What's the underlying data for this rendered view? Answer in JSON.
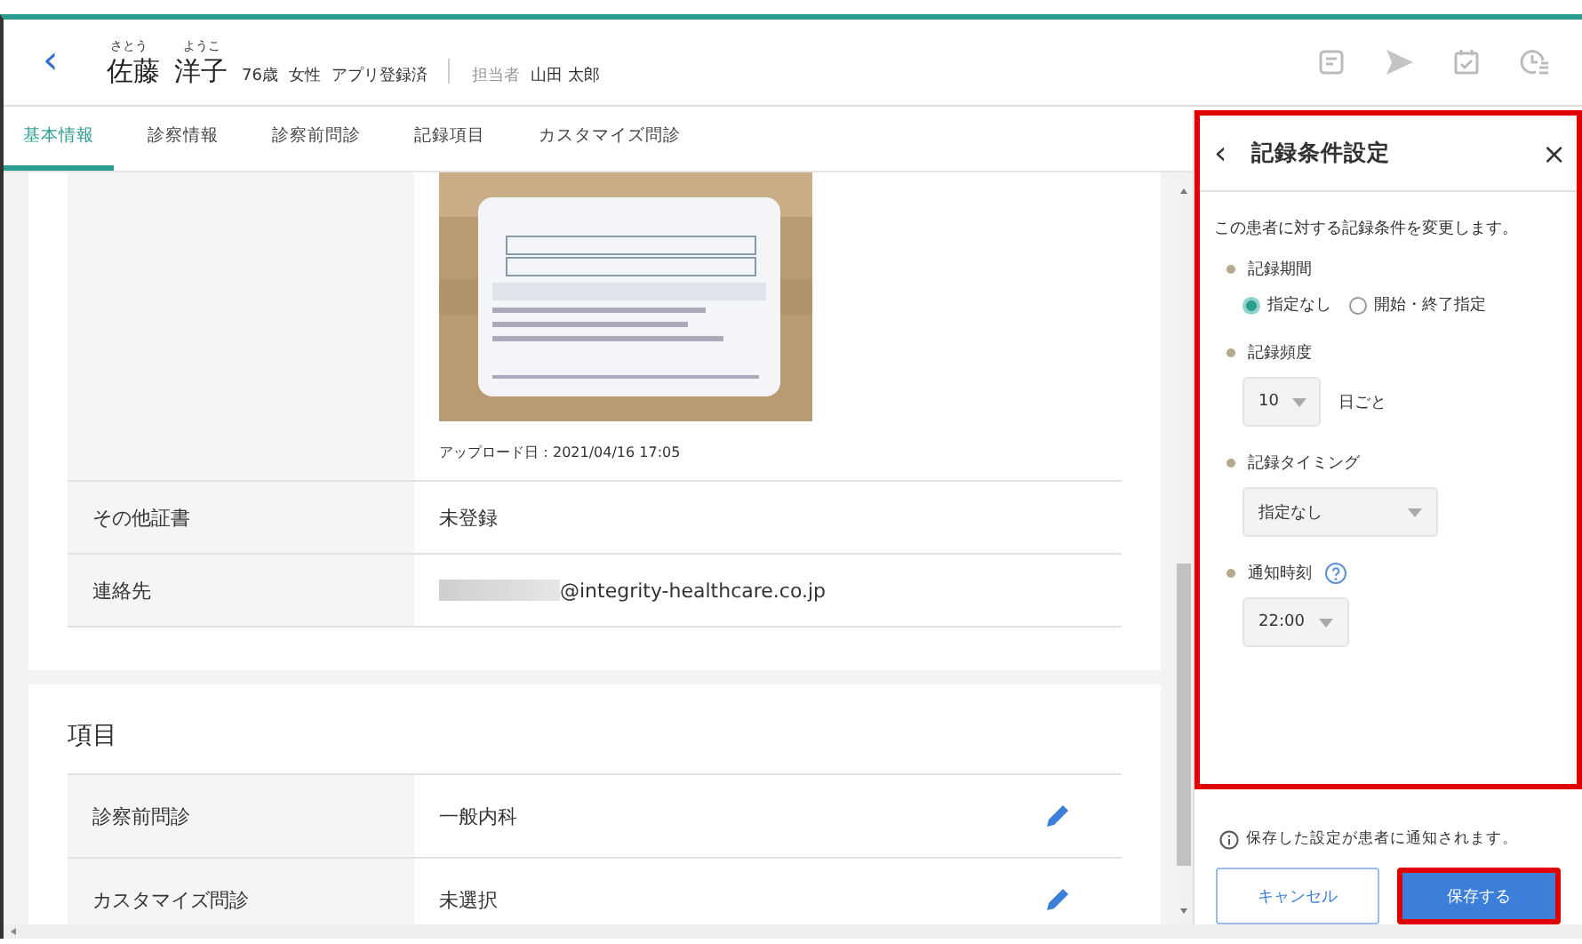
{
  "header": {
    "back": "‹",
    "furigana_family": "さとう",
    "furigana_given": "ようこ",
    "family": "佐藤",
    "given": "洋子",
    "age": "76歳",
    "gender": "女性",
    "status": "アプリ登録済",
    "staff_label": "担当者",
    "staff": "山田 太郎"
  },
  "toolbar": [
    {
      "kind": "memo"
    },
    {
      "kind": "send"
    },
    {
      "kind": "calendar"
    },
    {
      "kind": "clock"
    }
  ],
  "tabs": [
    {
      "label": "基本情報",
      "selected": true
    },
    {
      "label": "診察情報",
      "selected": false
    },
    {
      "label": "診察前問診",
      "selected": false
    },
    {
      "label": "記録項目",
      "selected": false
    },
    {
      "label": "カスタマイズ問診",
      "selected": false
    }
  ],
  "basic": {
    "photo": {
      "kind": "picture",
      "caption": "アップロード日：2021/04/16 17:05"
    },
    "rows": [
      {
        "label": "その他証書",
        "value": "未登録",
        "redacted": false
      },
      {
        "label": "連絡先",
        "value": "@integrity-healthcare.co.jp",
        "redacted": true
      }
    ]
  },
  "items": {
    "title": "項目",
    "rows": [
      {
        "label": "診察前問診",
        "value": "一般内科",
        "editable": true
      },
      {
        "label": "カスタマイズ問診",
        "value": "未選択",
        "editable": true
      }
    ]
  },
  "panel": {
    "back": "‹",
    "title": "記録条件設定",
    "close": "×",
    "highlighted": true,
    "description": "この患者に対する記録条件を変更します。",
    "fields": [
      {
        "kind": "radio",
        "label": "記録期間",
        "options": [
          {
            "label": "指定なし",
            "selected": true
          },
          {
            "label": "開始・終了指定",
            "selected": false
          }
        ]
      },
      {
        "kind": "select",
        "label": "記録頻度",
        "value": "10",
        "unit": "日ごと"
      },
      {
        "kind": "select",
        "label": "記録タイミング",
        "value": "指定なし"
      },
      {
        "kind": "select",
        "label": "通知時刻",
        "value": "22:00",
        "help": true
      }
    ],
    "note": "保存した設定が患者に通知されます。",
    "cancel": "キャンセル",
    "save": {
      "label": "保存する",
      "highlighted": true
    }
  }
}
